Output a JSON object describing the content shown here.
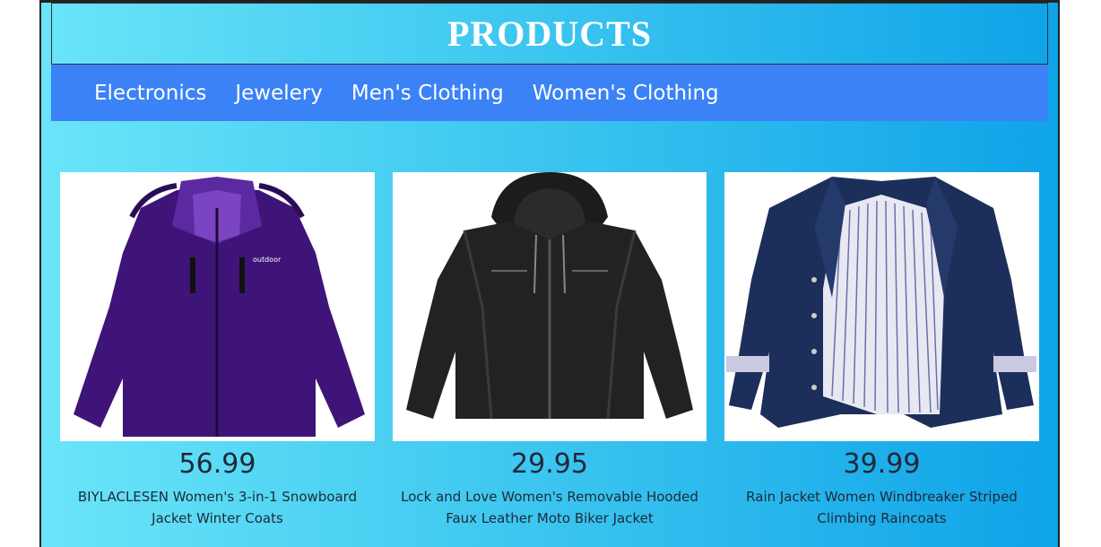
{
  "header": {
    "title": "PRODUCTS"
  },
  "nav": {
    "items": [
      {
        "label": "Electronics"
      },
      {
        "label": "Jewelery"
      },
      {
        "label": "Men's Clothing"
      },
      {
        "label": "Women's Clothing"
      }
    ]
  },
  "products": [
    {
      "price": "56.99",
      "title": "BIYLACLESEN Women's 3-in-1 Snowboard Jacket Winter Coats",
      "brand_text": "outdoor"
    },
    {
      "price": "29.95",
      "title": "Lock and Love Women's Removable Hooded Faux Leather Moto Biker Jacket"
    },
    {
      "price": "39.99",
      "title": "Rain Jacket Women Windbreaker Striped Climbing Raincoats"
    }
  ],
  "colors": {
    "nav_bg": "#3b82f6",
    "gradient_start": "#6ae5f8",
    "gradient_end": "#0fa3e8"
  }
}
